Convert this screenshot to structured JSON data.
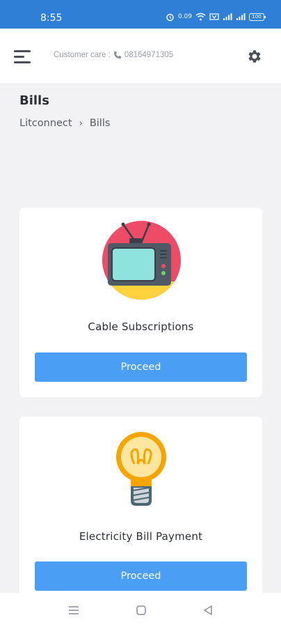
{
  "status_bar": {
    "time": "8:55",
    "speed": "0.09",
    "battery": "100"
  },
  "header": {
    "customer_care_label": "Customer care :",
    "customer_care_phone": "08164971305"
  },
  "page": {
    "title": "Bills",
    "breadcrumb": [
      "Litconnect",
      "Bills"
    ]
  },
  "cards": [
    {
      "title": "Cable Subscriptions",
      "button": "Proceed",
      "icon": "tv-icon"
    },
    {
      "title": "Electricity Bill Payment",
      "button": "Proceed",
      "icon": "lightbulb-icon"
    }
  ],
  "colors": {
    "status_bar": "#2f7fd6",
    "button": "#4a9ff5",
    "background": "#f2f2f4"
  }
}
